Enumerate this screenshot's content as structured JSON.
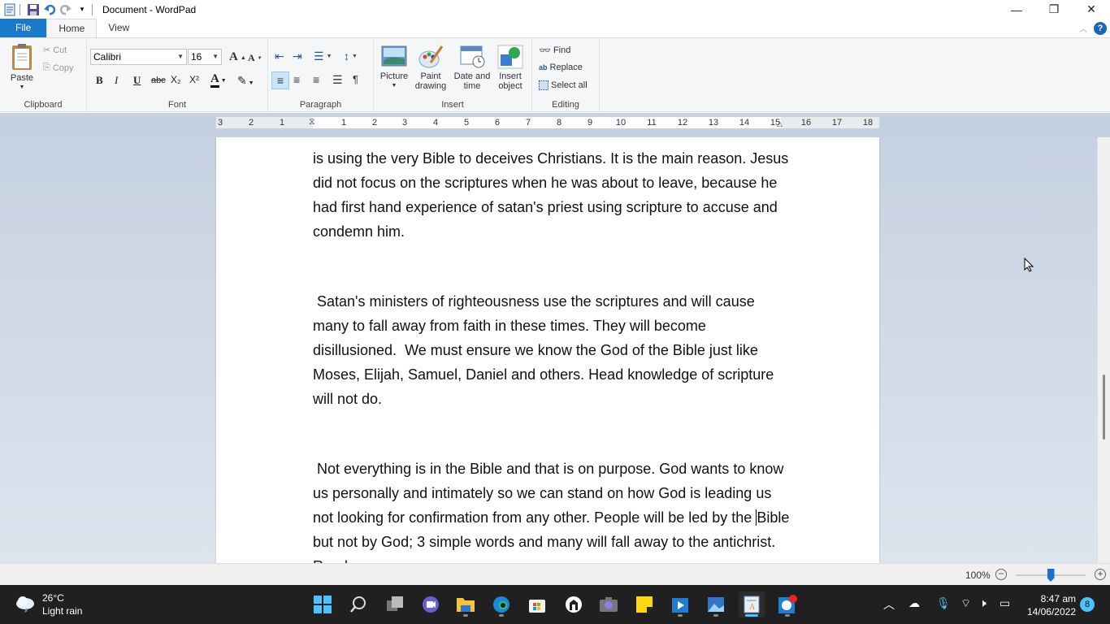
{
  "window": {
    "title": "Document - WordPad",
    "controls": {
      "minimize": "—",
      "maximize": "❐",
      "close": "✕"
    }
  },
  "tabs": [
    {
      "label": "File"
    },
    {
      "label": "Home"
    },
    {
      "label": "View"
    }
  ],
  "ribbon": {
    "clipboard": {
      "paste": "Paste",
      "cut": "Cut",
      "copy": "Copy",
      "group_label": "Clipboard"
    },
    "font": {
      "family": "Calibri",
      "size": "16",
      "group_label": "Font",
      "bold": "B",
      "italic": "I",
      "underline": "U",
      "strike": "abc",
      "subscript": "X₂",
      "superscript": "X²",
      "color_letter": "A"
    },
    "paragraph": {
      "group_label": "Paragraph"
    },
    "insert": {
      "picture": "Picture",
      "paint_drawing_l1": "Paint",
      "paint_drawing_l2": "drawing",
      "date_time_l1": "Date and",
      "date_time_l2": "time",
      "insert_object_l1": "Insert",
      "insert_object_l2": "object",
      "group_label": "Insert"
    },
    "editing": {
      "find": "Find",
      "replace": "Replace",
      "select_all": "Select all",
      "group_label": "Editing"
    }
  },
  "ruler": {
    "left_ticks": [
      "3",
      "2",
      "1"
    ],
    "right_ticks": [
      "1",
      "2",
      "3",
      "4",
      "5",
      "6",
      "7",
      "8",
      "9",
      "10",
      "11",
      "12",
      "13",
      "14",
      "15",
      "16",
      "17",
      "18"
    ]
  },
  "document": {
    "paragraphs": [
      "is using the very Bible to deceives Christians. It is the main reason. Jesus did not focus on the scriptures when he was about to leave, because he had first hand experience of satan's priest using scripture to accuse and condemn him.",
      " Satan's ministers of righteousness use the scriptures and will cause many to fall away from faith in these times. They will become disillusioned.  We must ensure we know the God of the Bible just like Moses, Elijah, Samuel, Daniel and others. Head knowledge of scripture will not do."
    ],
    "p3_before_caret": " Not everything is in the Bible and that is on purpose. God wants to know us personally and intimately so we can stand on how God is leading us not looking for confirmation from any other. People will be led by the ",
    "p3_after_caret": "Bible but not by God; 3 simple words and many will fall away to the antichrist. Read ..."
  },
  "status": {
    "zoom": "100%",
    "zoom_slider_fraction": 0.5
  },
  "taskbar": {
    "weather_temp": "26°C",
    "weather_desc": "Light rain",
    "time": "8:47 am",
    "date": "14/06/2022",
    "notifications": "8"
  }
}
